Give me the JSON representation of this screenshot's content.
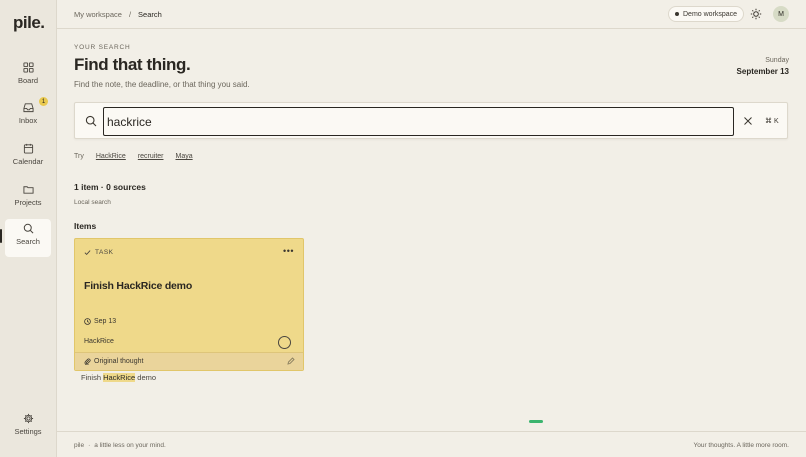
{
  "app": {
    "logo": "pile.",
    "footer_brand": "pile",
    "footer_tagline": "a little less on your mind.",
    "footer_right": "Your thoughts. A little more room."
  },
  "sidebar": {
    "items": [
      {
        "label": "Board",
        "icon": "grid-icon"
      },
      {
        "label": "Inbox",
        "icon": "inbox-icon",
        "badge": "1"
      },
      {
        "label": "Calendar",
        "icon": "calendar-icon"
      },
      {
        "label": "Projects",
        "icon": "folder-icon"
      },
      {
        "label": "Search",
        "icon": "search-icon",
        "active": true
      },
      {
        "label": "Settings",
        "icon": "gear-icon"
      }
    ]
  },
  "header": {
    "breadcrumb_root": "My workspace",
    "breadcrumb_sep": "/",
    "breadcrumb_current": "Search",
    "workspace_label": "Demo workspace",
    "avatar_initial": "M"
  },
  "page": {
    "eyebrow": "YOUR SEARCH",
    "title": "Find that thing.",
    "subtitle": "Find the note, the deadline, or that thing you said.",
    "date_day": "Sunday",
    "date_full": "September 13"
  },
  "search": {
    "value": "hackrice",
    "shortcut": "⌘ K",
    "try_label": "Try",
    "suggestions": [
      "HackRice",
      "recruiter",
      "Maya"
    ]
  },
  "results": {
    "count": "1 item · 0 sources",
    "mode": "Local search",
    "items_heading": "Items",
    "card": {
      "type": "TASK",
      "more": "•••",
      "title": "Finish HackRice demo",
      "date": "Sep 13",
      "project": "HackRice",
      "footer": "Original thought"
    },
    "snippet_before": "Finish ",
    "snippet_match": "HackRice",
    "snippet_after": " demo"
  },
  "colors": {
    "accent_card": "#efd98a",
    "progress": "#3bb46e",
    "background": "#f2efe7"
  }
}
